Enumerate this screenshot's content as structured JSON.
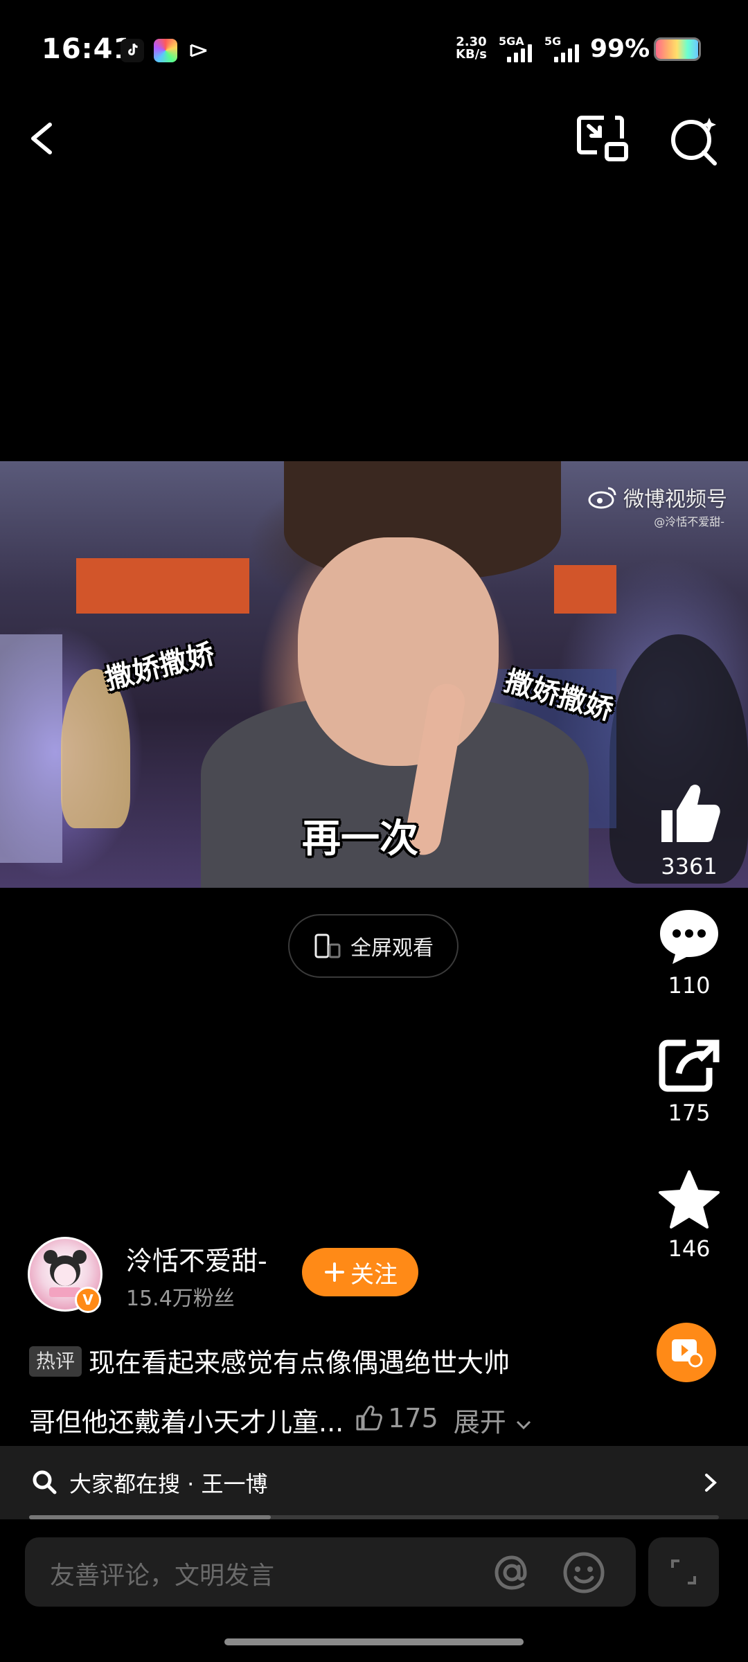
{
  "status_bar": {
    "time": "16:41",
    "net_speed_value": "2.30",
    "net_speed_unit": "KB/s",
    "sim1_label": "5GA",
    "sim2_label": "5G",
    "battery": "99%",
    "app_icons": [
      "tiktok-icon",
      "photos-icon",
      "capcut-icon"
    ]
  },
  "nav": {
    "back_icon": "chevron-left-icon",
    "pip_icon": "picture-in-picture-icon",
    "search_icon": "search-icon"
  },
  "video": {
    "watermark": "微博视频号",
    "watermark_handle": "@泠恬不爱甜-",
    "sticker_left": "撒娇撒娇",
    "sticker_right": "撒娇撒娇",
    "sticker_center": "再一次"
  },
  "fullscreen": {
    "label": "全屏观看"
  },
  "actions": {
    "likes": "3361",
    "comments": "110",
    "shares": "175",
    "favorites": "146"
  },
  "author": {
    "name": "泠恬不爱甜-",
    "fans": "15.4万粉丝",
    "follow_label": "关注"
  },
  "hot_comment": {
    "tag": "热评",
    "text_line1": "现在看起来感觉有点像偶遇绝世大帅",
    "text_line2": "哥但他还戴着小天才儿童...",
    "likes": "175",
    "expand": "展开"
  },
  "search_strip": {
    "text": "大家都在搜 · 王一博",
    "progress": 0.35
  },
  "comment_input": {
    "placeholder": "友善评论，文明发言"
  },
  "colors": {
    "accent": "#ff8a17",
    "background": "#000000",
    "muted": "#9a9a9a"
  }
}
